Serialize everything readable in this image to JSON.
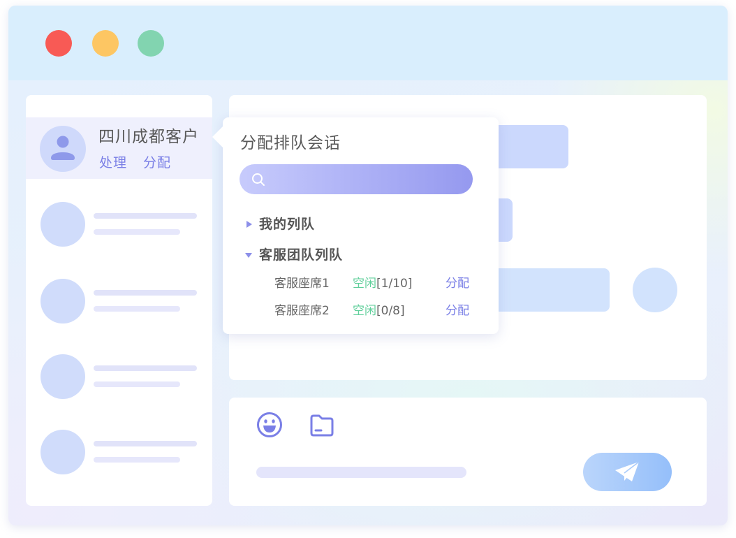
{
  "window": {
    "title_bar_color": "#d9eefd",
    "controls": [
      {
        "color": "#f85a55"
      },
      {
        "color": "#fdc663"
      },
      {
        "color": "#82d4b0"
      }
    ]
  },
  "theme": {
    "accent": "#7a7fe6",
    "idle_status": "#60cf9b"
  },
  "sidebar": {
    "active_contact": {
      "avatar_icon": "user-icon",
      "name": "四川成都客户",
      "actions": [
        "处理",
        "分配"
      ]
    }
  },
  "assign_popup": {
    "title": "分配排队会话",
    "search_icon": "search-icon",
    "queues": [
      {
        "label": "我的列队",
        "expanded": false,
        "toggle_icon": "caret-right-icon"
      },
      {
        "label": "客服团队列队",
        "expanded": true,
        "toggle_icon": "caret-down-icon",
        "agents": [
          {
            "name": "客服座席1",
            "status": "空闲",
            "load": "[1/10]",
            "action": "分配"
          },
          {
            "name": "客服座席2",
            "status": "空闲",
            "load": "[0/8]",
            "action": "分配"
          }
        ]
      }
    ]
  },
  "composer": {
    "tool_icons": [
      "emoji-icon",
      "folder-icon"
    ],
    "send_icon": "paper-plane-icon"
  }
}
